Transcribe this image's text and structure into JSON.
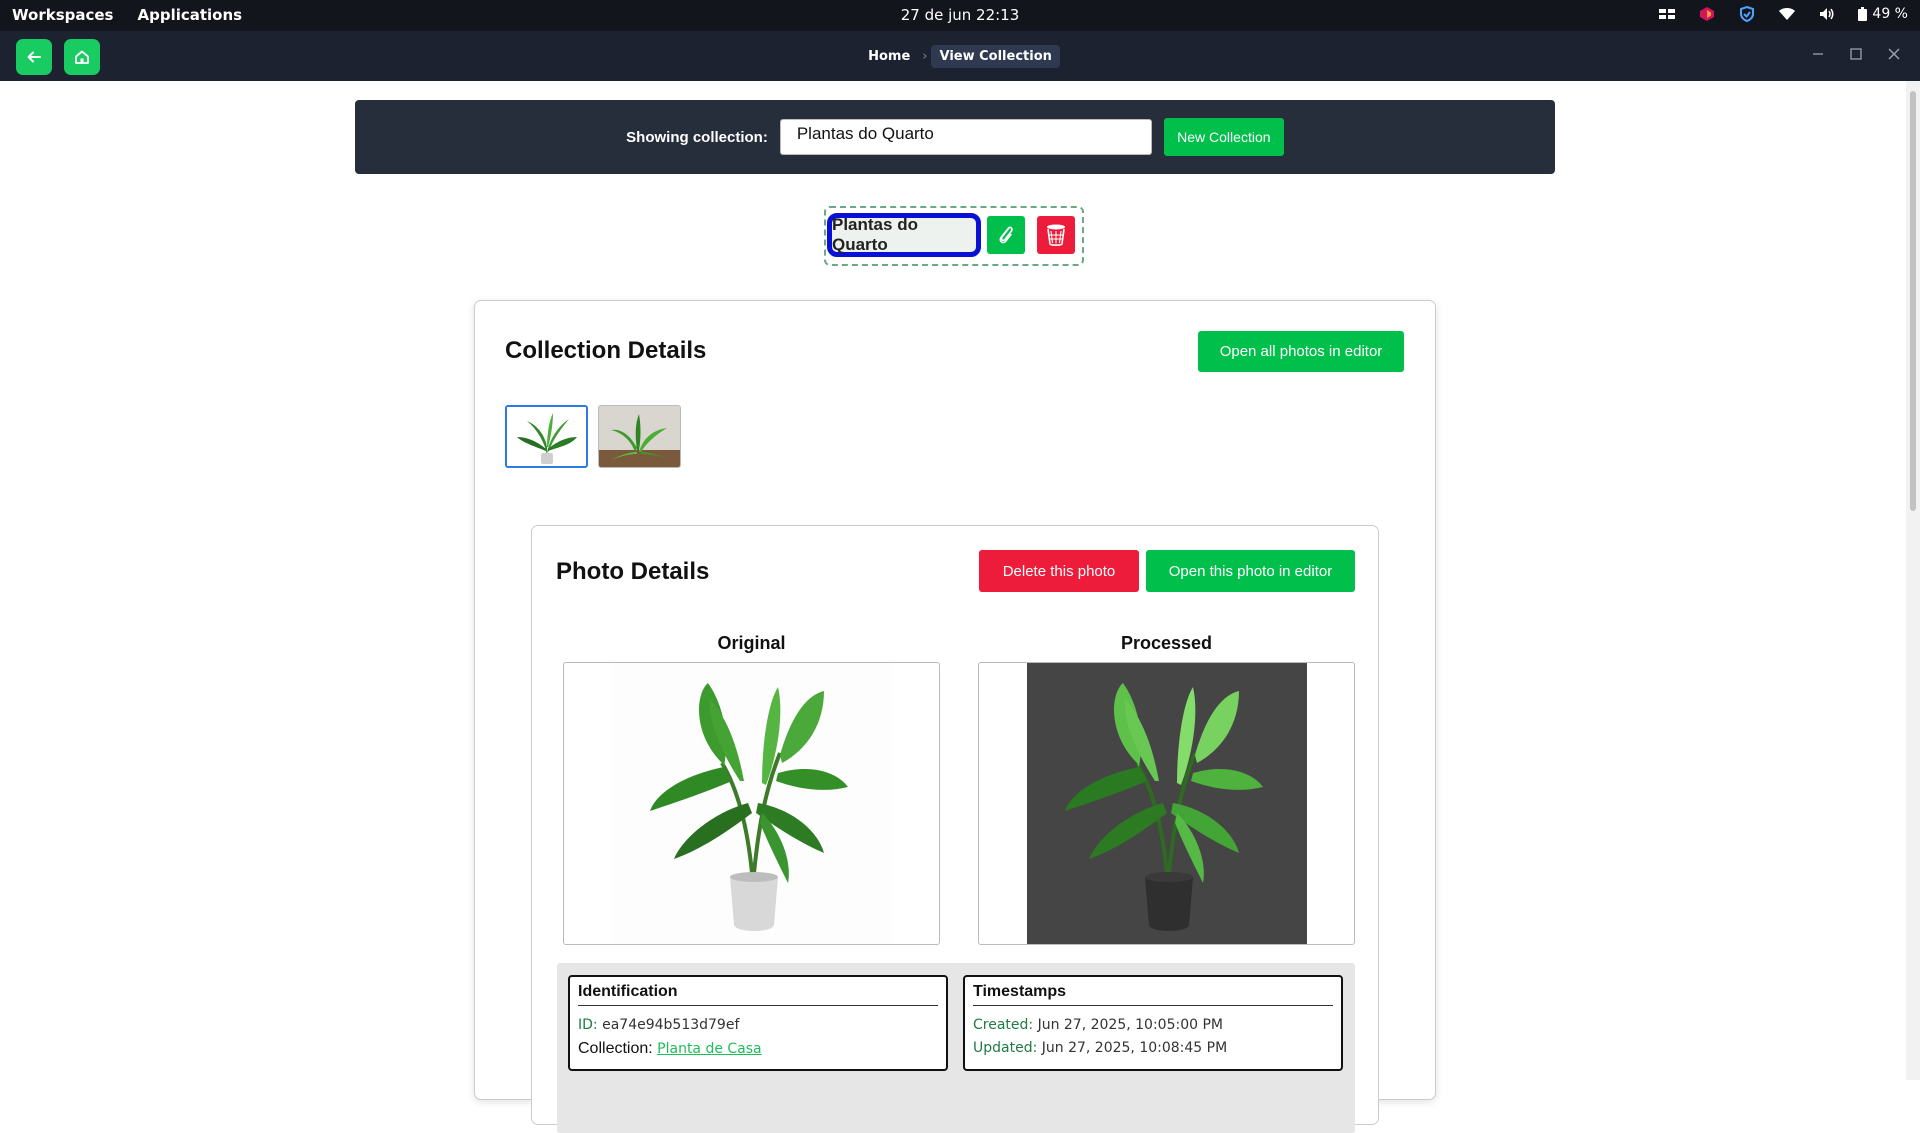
{
  "os": {
    "workspaces": "Workspaces",
    "applications": "Applications",
    "clock": "27 de jun  22:13",
    "battery": "49 %"
  },
  "header": {
    "breadcrumb": [
      "Home",
      "View Collection"
    ]
  },
  "selector": {
    "label": "Showing collection:",
    "value": "Plantas do Quarto",
    "new_button": "New Collection"
  },
  "chip": {
    "name": "Plantas do Quarto"
  },
  "collection_details": {
    "title": "Collection Details",
    "open_all_button": "Open all photos in editor"
  },
  "photo_details": {
    "title": "Photo Details",
    "delete_button": "Delete this photo",
    "open_button": "Open this photo in editor",
    "original_label": "Original",
    "processed_label": "Processed"
  },
  "identification": {
    "heading": "Identification",
    "id_key": "ID:",
    "id_value": "ea74e94b513d79ef",
    "collection_key": "Collection:",
    "collection_link": "Planta de Casa"
  },
  "timestamps": {
    "heading": "Timestamps",
    "created_key": "Created:",
    "created_value": "Jun 27, 2025, 10:05:00 PM",
    "updated_key": "Updated:",
    "updated_value": "Jun 27, 2025, 10:08:45 PM"
  },
  "colors": {
    "accent_green": "#00c04b",
    "danger_red": "#ed1c3a",
    "header_dark": "#1d2231",
    "selected_outline": "#0a11d6"
  }
}
